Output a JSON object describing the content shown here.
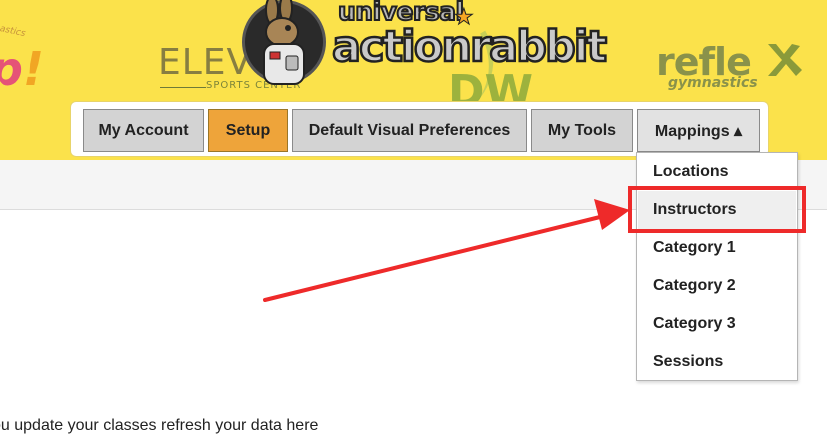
{
  "banner": {
    "brand": {
      "word1": "universal",
      "star": "★",
      "word2": "actionrabbit"
    },
    "partners": {
      "left_small": "nastics",
      "left_big_a": "p",
      "left_big_b": "!",
      "elev": "ELEV-",
      "elev_sub": "SPORTS CENTER",
      "dw": "DW",
      "reflex": "refle",
      "reflex_sub": "gymnastics"
    }
  },
  "nav": {
    "tabs": [
      {
        "label": "My Account"
      },
      {
        "label": "Setup",
        "active": true
      },
      {
        "label": "Default Visual Preferences"
      },
      {
        "label": "My Tools"
      },
      {
        "label": "Mappings ▴",
        "open": true
      }
    ]
  },
  "mappings_menu": {
    "items": [
      "Locations",
      "Instructors",
      "Category 1",
      "Category 2",
      "Category 3",
      "Sessions"
    ],
    "highlighted": "Instructors"
  },
  "annotation": {
    "box_color": "#ee2a2a",
    "arrow_color": "#ee2a2a"
  },
  "body": {
    "text": "ou update your classes refresh your data here"
  },
  "colors": {
    "banner": "#fbe24b",
    "active_tab": "#eea43a",
    "tab": "#d3d3d3"
  }
}
